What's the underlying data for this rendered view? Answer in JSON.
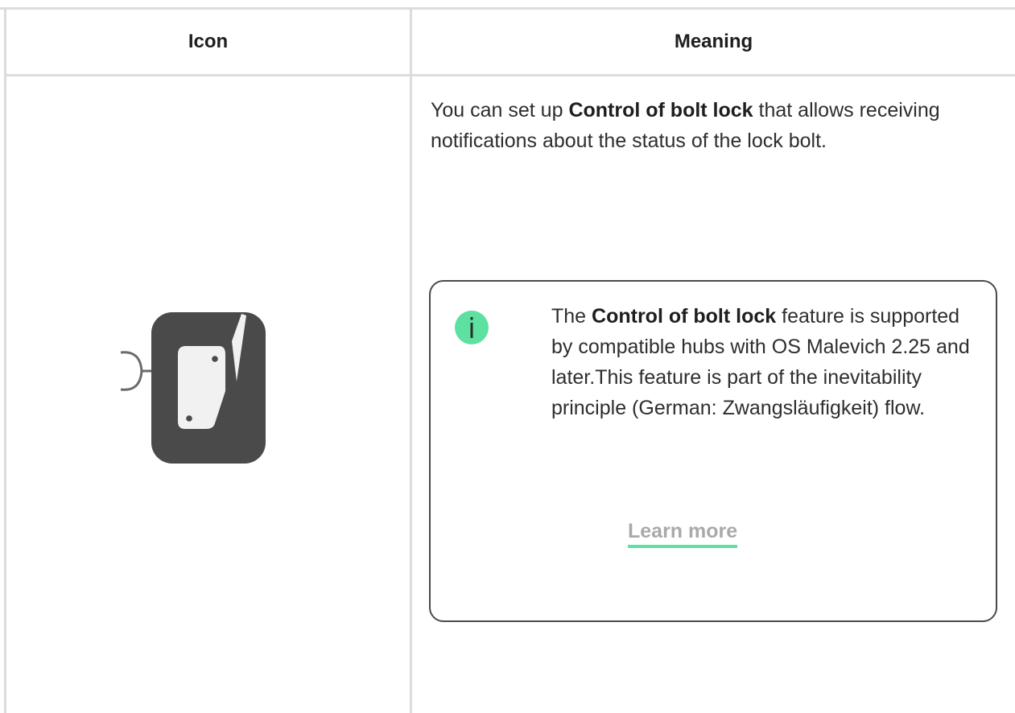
{
  "table": {
    "headers": {
      "icon": "Icon",
      "meaning": "Meaning"
    },
    "row": {
      "icon_name": "bolt-lock-control-device-icon",
      "description": {
        "before": "You can set up ",
        "bold": "Control of bolt lock",
        "after": " that allows receiving notifications about the status of the lock bolt."
      },
      "note": {
        "badge_icon": "info-icon",
        "before": "The ",
        "bold": "Control of bolt lock",
        "after": " feature is supported by compatible hubs with OS Malevich 2.25 and later.This feature is part of the inevitability principle (German: Zwangsläufigkeit) flow.",
        "link_label": "Learn more"
      }
    }
  },
  "colors": {
    "accent": "#5ee0a0",
    "icon_bg": "#4a4a4a",
    "border": "#dcdcdc",
    "link_text": "#a9a9a9"
  }
}
